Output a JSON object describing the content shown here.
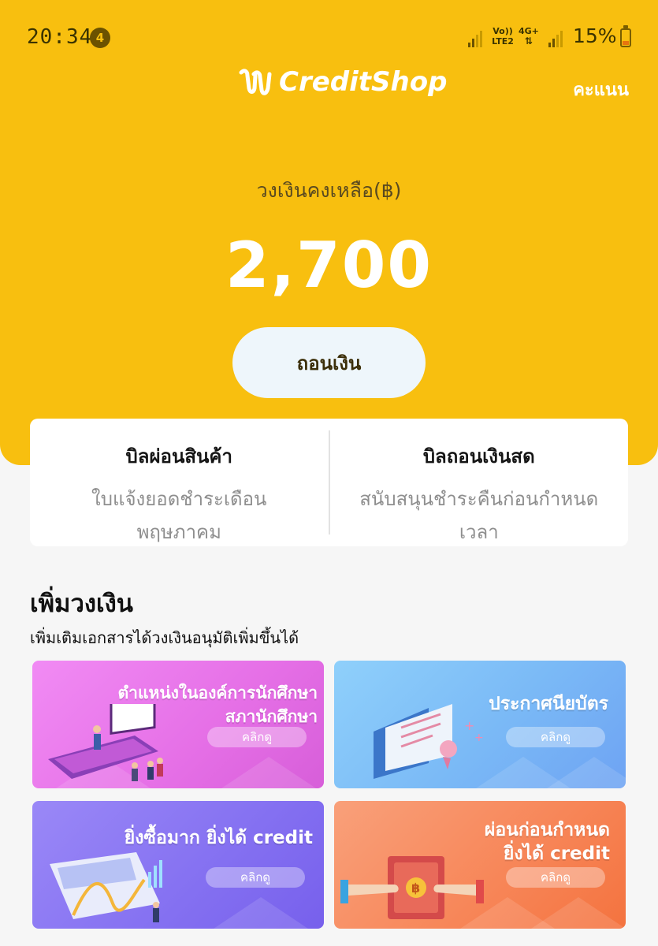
{
  "status_bar": {
    "time": "20:34",
    "notification_count": "4",
    "volte_label": "Vo)) LTE2",
    "network_label": "4G+",
    "battery_percent": "15%",
    "battery_level": 0.15
  },
  "header": {
    "app_name": "CreditShop",
    "score_label": "คะแนน"
  },
  "balance": {
    "label": "วงเงินคงเหลือ(฿)",
    "value": "2,700",
    "withdraw_label": "ถอนเงิน"
  },
  "bills": [
    {
      "title": "บิลผ่อนสินค้า",
      "subtitle_line1": "ใบแจ้งยอดชำระเดือน",
      "subtitle_line2": "พฤษภาคม"
    },
    {
      "title": "บิลถอนเงินสด",
      "subtitle_line1": "สนับสนุนชำระคืนก่อนกำหนด",
      "subtitle_line2": "เวลา"
    }
  ],
  "increase_section": {
    "title": "เพิ่มวงเงิน",
    "subtitle": "เพิ่มเติมเอกสารได้วงเงินอนุมัติเพิ่มขึ้นได้"
  },
  "tiles": [
    {
      "line1": "ตำแหน่งในองค์การนักศึกษา",
      "line2": "สภานักศึกษา",
      "button": "คลิกดู",
      "color": "#e56fe6"
    },
    {
      "line1": "ประกาศนียบัตร",
      "line2": "",
      "button": "คลิกดู",
      "color": "#7ab9f6"
    },
    {
      "line1": "ยิ่งซื้อมาก ยิ่งได้ credit",
      "line2": "",
      "button": "คลิกดู",
      "color": "#8470f1"
    },
    {
      "line1": "ผ่อนก่อนกำหนด",
      "line2": "ยิ่งได้ credit",
      "button": "คลิกดู",
      "color": "#f78557"
    }
  ],
  "colors": {
    "brand_yellow": "#f8bf0f",
    "page_bg": "#f6f6f6"
  },
  "icons": [
    "signal-icon",
    "battery-icon",
    "creditshop-logo-icon"
  ]
}
